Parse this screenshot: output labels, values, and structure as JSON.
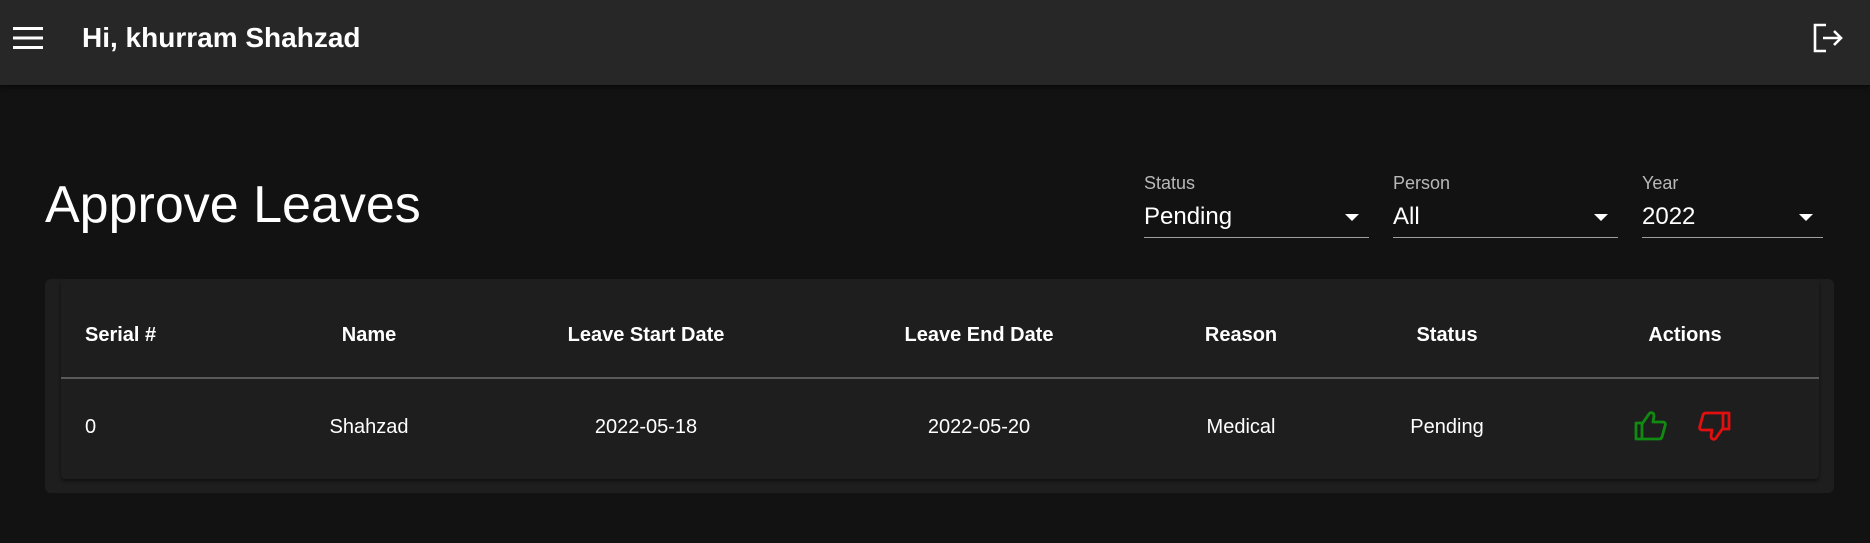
{
  "appbar": {
    "greeting": "Hi, khurram Shahzad",
    "menu_icon": "menu-icon",
    "logout_icon": "logout-icon"
  },
  "page": {
    "title": "Approve Leaves"
  },
  "filters": {
    "status": {
      "label": "Status",
      "value": "Pending"
    },
    "person": {
      "label": "Person",
      "value": "All"
    },
    "year": {
      "label": "Year",
      "value": "2022"
    }
  },
  "table": {
    "headers": {
      "serial": "Serial #",
      "name": "Name",
      "start": "Leave Start Date",
      "end": "Leave End Date",
      "reason": "Reason",
      "status": "Status",
      "actions": "Actions"
    },
    "rows": [
      {
        "serial": "0",
        "name": "Shahzad",
        "start": "2022-05-18",
        "end": "2022-05-20",
        "reason": "Medical",
        "status": "Pending",
        "approve_icon": "thumbs-up-icon",
        "reject_icon": "thumbs-down-icon"
      }
    ]
  },
  "colors": {
    "background": "#121212",
    "appbar": "#272727",
    "card": "#1e1e1e",
    "approve": "#118a11",
    "reject": "#e01010"
  }
}
